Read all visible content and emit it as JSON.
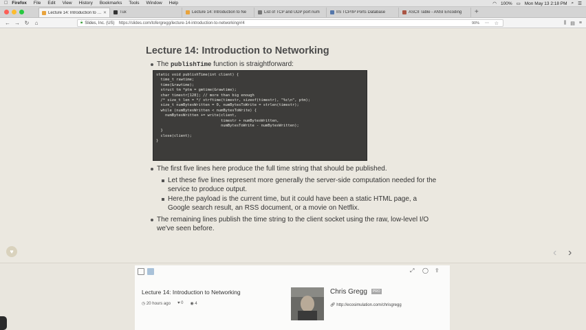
{
  "menubar": {
    "apple": "",
    "menus": [
      "Firefox",
      "File",
      "Edit",
      "View",
      "History",
      "Bookmarks",
      "Tools",
      "Window",
      "Help"
    ],
    "battery": "100%",
    "datetime": "Mon May 13  2:18 PM"
  },
  "tabs": [
    {
      "title": "Lecture 14: Introduction to Net"
    },
    {
      "title": "Tux"
    },
    {
      "title": "Lecture 14: Introduction to Ne"
    },
    {
      "title": "List of TCP and UDP port num"
    },
    {
      "title": "IIS TCP/IP Ports Database"
    },
    {
      "title": "ASCII Table - ANSI Encoding"
    }
  ],
  "nav": {
    "site": "Slides, Inc. (US)",
    "url": "https://slides.com/tofergregg/lecture-14-introduction-to-networking#/4",
    "zoom": "90%"
  },
  "slide": {
    "title": "Lecture 14: Introduction to Networking",
    "intro_pre": "The ",
    "intro_code": "publishTime",
    "intro_post": " function is straightforward:",
    "code": "static void publishTime(int client) {\n  time_t rawtime;\n  time(&rawtime);\n  struct tm *ptm = gmtime(&rawtime);\n  char timestr[128]; // more than big enough\n  /* size_t len = */ strftime(timestr, sizeof(timestr), \"%c\\n\", ptm);\n  size_t numBytesWritten = 0, numBytesToWrite = strlen(timestr);\n  while (numBytesWritten < numBytesToWrite) {\n    numBytesWritten += write(client,\n                             timestr + numBytesWritten,\n                             numBytesToWrite - numBytesWritten);\n  }\n  close(client);\n}",
    "bullet1": "The first five lines here produce the full time string that should be published.",
    "sub1": "Let these five lines represent more generally the server-side computation needed for the service to produce output.",
    "sub2": "Here,the payload is the current time, but it could have been a static HTML page, a Google search result, an RSS document, or a movie on Netflix.",
    "bullet2": "The remaining lines publish the time string to the client socket using the raw, low-level I/O we've seen before."
  },
  "info": {
    "lecture_title": "Lecture 14: Introduction to Networking",
    "posted": "20 hours ago",
    "likes": "0",
    "views": "4",
    "author": "Chris Gregg",
    "badge": "PRO",
    "author_url": "http://ecosimulation.com/chrisgregg"
  },
  "colors": {
    "code_bg": "#3d3c3a",
    "slide_bg": "#ebe8e0"
  }
}
